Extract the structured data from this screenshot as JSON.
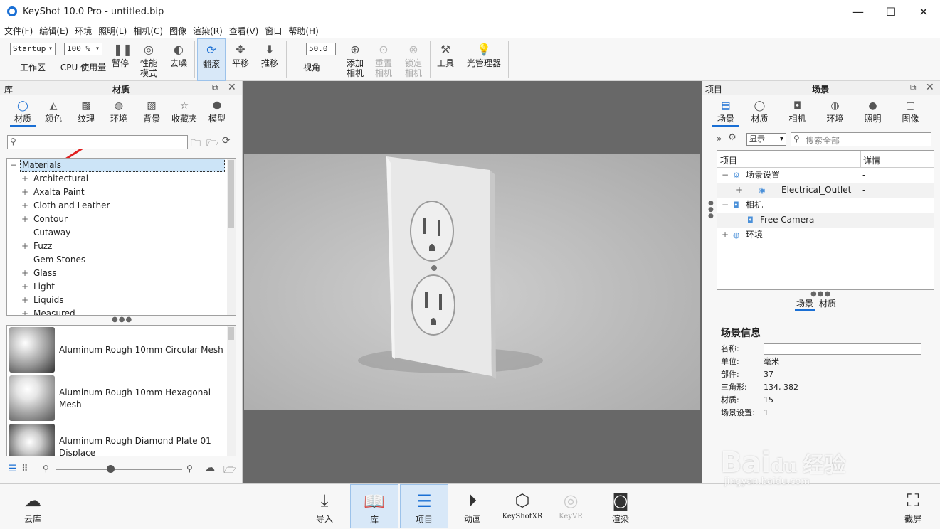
{
  "window": {
    "title": "KeyShot 10.0 Pro  - untitled.bip",
    "minimize": "—",
    "maximize": "☐",
    "close": "✕"
  },
  "menu": [
    "文件(F)",
    "编辑(E)",
    "环境",
    "照明(L)",
    "相机(C)",
    "图像",
    "渲染(R)",
    "查看(V)",
    "窗口",
    "帮助(H)"
  ],
  "toolbar": {
    "workspace_value": "Startup",
    "workspace_label": "工作区",
    "cpu_value": "100 %",
    "cpu_label": "CPU 使用量",
    "pause": "暂停",
    "perf1": "性能",
    "perf2": "模式",
    "denoise": "去噪",
    "tumble": "翻滚",
    "pan": "平移",
    "dolly": "推移",
    "fov_value": "50.0",
    "fov_label": "视角",
    "add_cam1": "添加",
    "add_cam2": "相机",
    "reset_cam1": "重置",
    "reset_cam2": "相机",
    "lock_cam1": "锁定",
    "lock_cam2": "相机",
    "tools": "工具",
    "light_mgr": "光管理器"
  },
  "library": {
    "left_title": "库",
    "title": "材质",
    "tabs": [
      "材质",
      "颜色",
      "纹理",
      "环境",
      "背景",
      "收藏夹",
      "模型"
    ],
    "search_placeholder": "",
    "tree": [
      {
        "label": "Materials",
        "exp": "−",
        "selected": true
      },
      {
        "label": "Architectural",
        "exp": "+"
      },
      {
        "label": "Axalta Paint",
        "exp": "+"
      },
      {
        "label": "Cloth and Leather",
        "exp": "+"
      },
      {
        "label": "Contour",
        "exp": "+"
      },
      {
        "label": "Cutaway",
        "exp": ""
      },
      {
        "label": "Fuzz",
        "exp": "+"
      },
      {
        "label": "Gem Stones",
        "exp": ""
      },
      {
        "label": "Glass",
        "exp": "+"
      },
      {
        "label": "Light",
        "exp": "+"
      },
      {
        "label": "Liquids",
        "exp": "+"
      },
      {
        "label": "Measured",
        "exp": "+"
      }
    ],
    "swatches": [
      {
        "line1": "Aluminum Rough 10mm Circular Mesh",
        "line2": ""
      },
      {
        "line1": "Aluminum Rough 10mm Hexagonal",
        "line2": "Mesh"
      },
      {
        "line1": "Aluminum Rough Diamond Plate 01",
        "line2": "Displace"
      }
    ]
  },
  "project": {
    "left_title": "项目",
    "title": "场景",
    "tabs": [
      "场景",
      "材质",
      "相机",
      "环境",
      "照明",
      "图像"
    ],
    "display_value": "显示",
    "search_placeholder": "搜索全部",
    "col_item": "项目",
    "col_detail": "详情",
    "tree": [
      {
        "exp": "−",
        "label": "场景设置",
        "detail": "-"
      },
      {
        "exp": "+",
        "label": "Electrical_Outlet",
        "detail": "-"
      },
      {
        "exp": "−",
        "label": "相机",
        "detail": ""
      },
      {
        "exp": "",
        "label": "Free Camera",
        "detail": "-"
      },
      {
        "exp": "+",
        "label": "环境",
        "detail": ""
      }
    ],
    "subtabs": [
      "场景",
      "材质"
    ],
    "info_title": "场景信息",
    "info": [
      {
        "k": "名称:",
        "v": ""
      },
      {
        "k": "单位:",
        "v": "毫米"
      },
      {
        "k": "部件:",
        "v": "37"
      },
      {
        "k": "三角形:",
        "v": "134, 382"
      },
      {
        "k": "材质:",
        "v": "15"
      },
      {
        "k": "场景设置:",
        "v": "1"
      }
    ]
  },
  "bottom": {
    "cloud": "云库",
    "import": "导入",
    "library": "库",
    "project": "项目",
    "animation": "动画",
    "keyshotxr": "KeyShotXR",
    "keyvr": "KeyVR",
    "render": "渲染",
    "screenshot": "截屏"
  },
  "watermark": {
    "brand": "Bai",
    "brand2": "du",
    "cn": "经验",
    "url": "jingyan.baidu.com"
  }
}
